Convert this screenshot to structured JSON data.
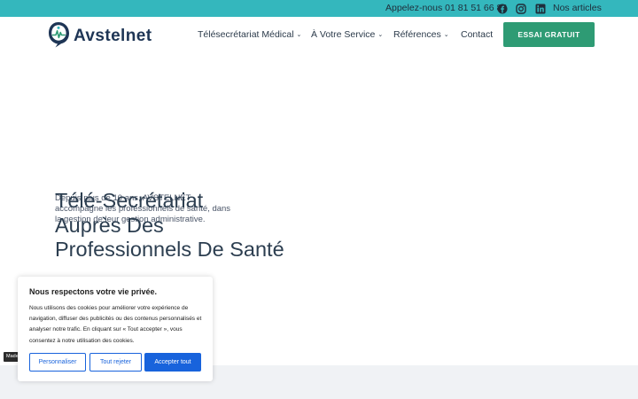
{
  "colors": {
    "topbar": "#34b7bd",
    "cta": "#2e9b74",
    "logo_text": "#1e3555",
    "cookie_accent": "#1863dc"
  },
  "topbar": {
    "phone": "Appelez-nous 01 81 51 66 86",
    "social_icons": [
      "facebook-icon",
      "instagram-icon",
      "linkedin-icon"
    ],
    "articles_link": "Nos articles"
  },
  "header": {
    "logo_text": "Avstelnet",
    "nav": [
      {
        "label": "Télésecrétariat Médical",
        "has_dropdown": true
      },
      {
        "label": "À Votre Service",
        "has_dropdown": true
      },
      {
        "label": "Références",
        "has_dropdown": true
      },
      {
        "label": "Contact",
        "has_dropdown": false
      }
    ],
    "cta_label": "ESSAI GRATUIT"
  },
  "hero": {
    "subtitle": "Depuis plus de 10 ans, AVSTELNET accompagne les professionnels de santé, dans la gestion de leur gestion administrative.",
    "title_lines": [
      "Télé-Secrétariat",
      "Auprès Des",
      "Professionnels De Santé"
    ]
  },
  "made_tag": "Made",
  "cookie": {
    "title": "Nous respectons votre vie privée.",
    "text": "Nous utilisons des cookies pour améliorer votre expérience de navigation, diffuser des publicités ou des contenus personnalisés et analyser notre trafic. En cliquant sur « Tout accepter », vous consentez à notre utilisation des cookies.",
    "buttons": {
      "customize": "Personnaliser",
      "reject": "Tout rejeter",
      "accept": "Accepter tout"
    }
  }
}
